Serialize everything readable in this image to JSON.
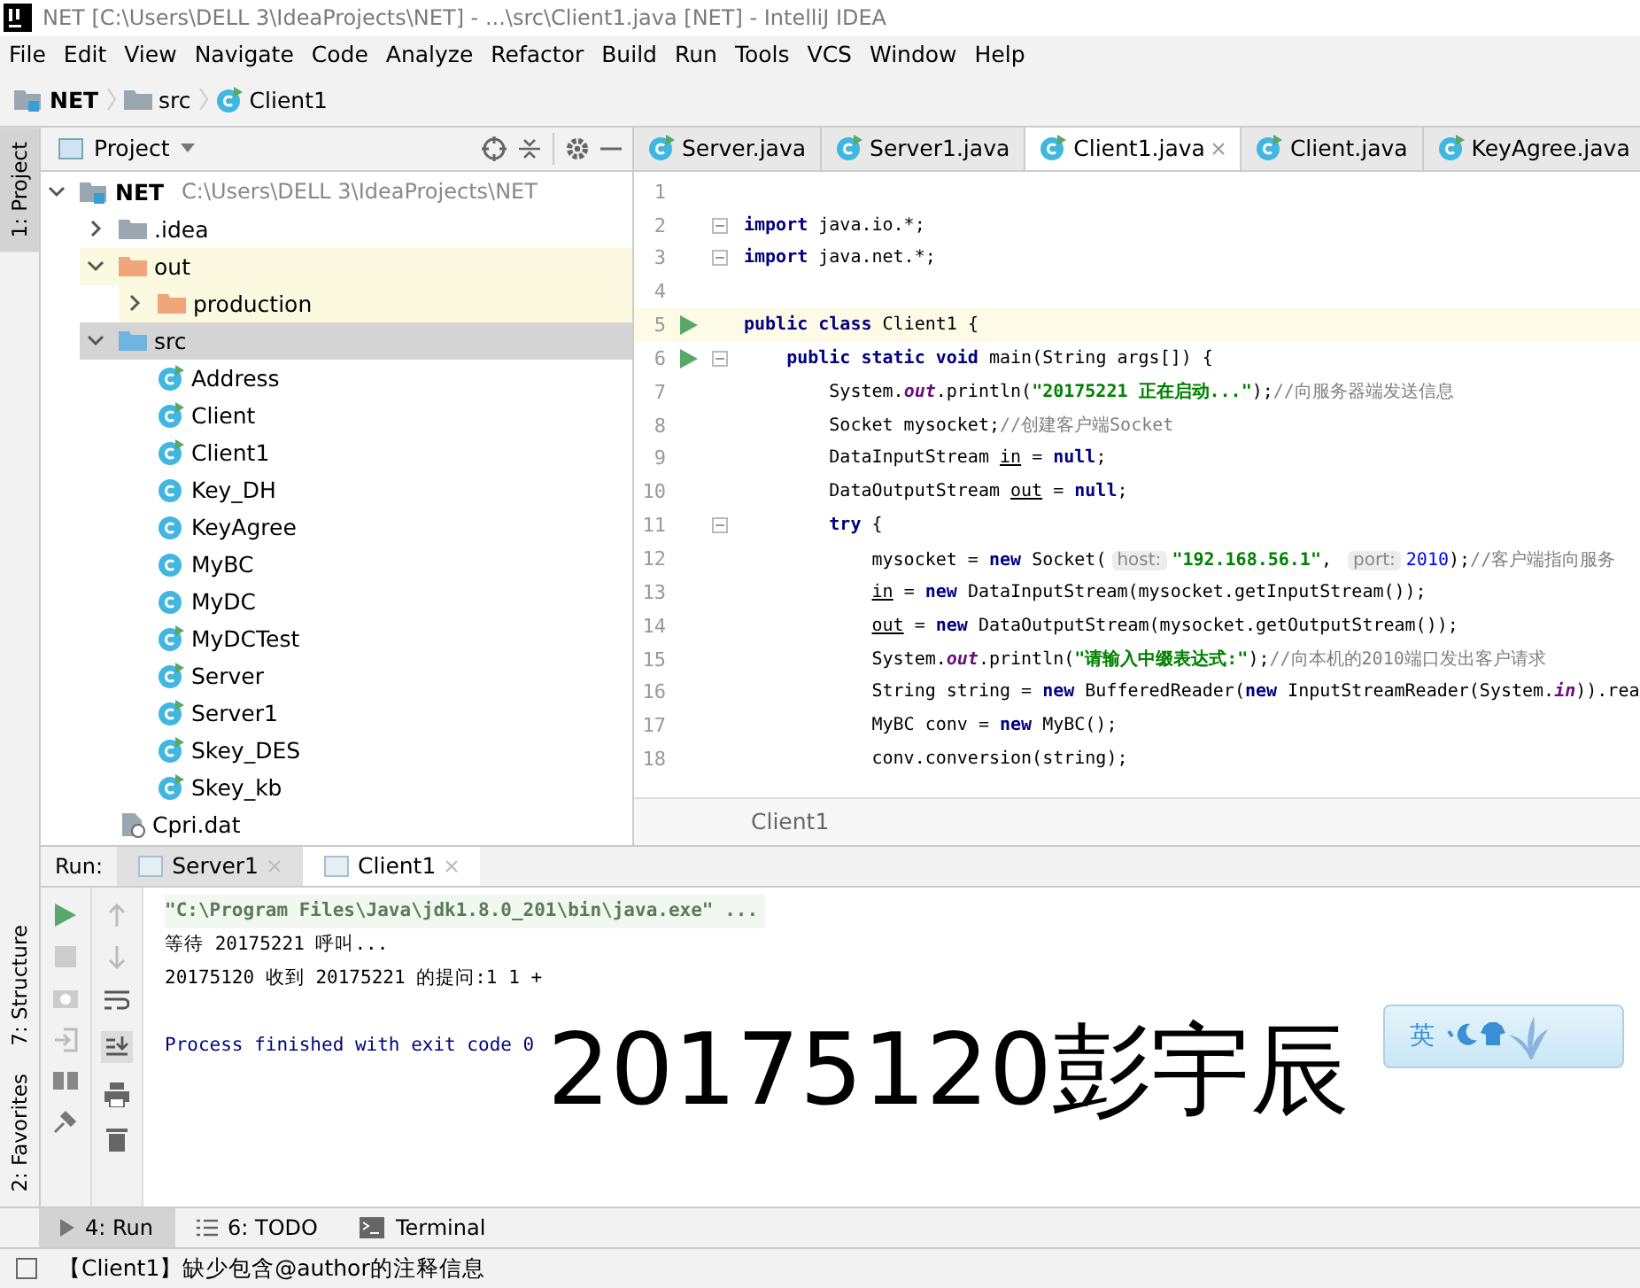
{
  "window": {
    "title": "NET [C:\\Users\\DELL 3\\IdeaProjects\\NET] - ...\\src\\Client1.java [NET] - IntelliJ IDEA"
  },
  "menu": [
    "File",
    "Edit",
    "View",
    "Navigate",
    "Code",
    "Analyze",
    "Refactor",
    "Build",
    "Run",
    "Tools",
    "VCS",
    "Window",
    "Help"
  ],
  "breadcrumb": [
    {
      "label": "NET",
      "kind": "module"
    },
    {
      "label": "src",
      "kind": "folder"
    },
    {
      "label": "Client1",
      "kind": "class"
    }
  ],
  "side_strip": [
    {
      "label": "1: Project",
      "selected": true
    },
    {
      "label": "7: Structure",
      "selected": false
    },
    {
      "label": "2: Favorites",
      "selected": false
    }
  ],
  "project_panel": {
    "title": "Project",
    "tree": [
      {
        "label": "NET",
        "path": "C:\\Users\\DELL 3\\IdeaProjects\\NET",
        "kind": "module",
        "expanded": true,
        "highlighted": false,
        "selected": false,
        "children": [
          {
            "label": ".idea",
            "kind": "folder",
            "expanded": false,
            "highlighted": false,
            "selected": false
          },
          {
            "label": "out",
            "kind": "excluded",
            "expanded": true,
            "highlighted": true,
            "selected": false,
            "children": [
              {
                "label": "production",
                "kind": "excluded",
                "expanded": false,
                "highlighted": true,
                "selected": false
              }
            ]
          },
          {
            "label": "src",
            "kind": "source",
            "expanded": true,
            "highlighted": false,
            "selected": true,
            "children": [
              {
                "label": "Address",
                "kind": "class",
                "runnable": true
              },
              {
                "label": "Client",
                "kind": "class",
                "runnable": true
              },
              {
                "label": "Client1",
                "kind": "class",
                "runnable": true
              },
              {
                "label": "Key_DH",
                "kind": "class",
                "runnable": false
              },
              {
                "label": "KeyAgree",
                "kind": "class",
                "runnable": false
              },
              {
                "label": "MyBC",
                "kind": "class",
                "runnable": false
              },
              {
                "label": "MyDC",
                "kind": "class",
                "runnable": false
              },
              {
                "label": "MyDCTest",
                "kind": "class",
                "runnable": true
              },
              {
                "label": "Server",
                "kind": "class",
                "runnable": true
              },
              {
                "label": "Server1",
                "kind": "class",
                "runnable": true
              },
              {
                "label": "Skey_DES",
                "kind": "class",
                "runnable": true
              },
              {
                "label": "Skey_kb",
                "kind": "class",
                "runnable": true
              }
            ]
          },
          {
            "label": "Cpri.dat",
            "kind": "file"
          }
        ]
      }
    ]
  },
  "editor": {
    "tabs": [
      {
        "label": "Server.java",
        "selected": false
      },
      {
        "label": "Server1.java",
        "selected": false
      },
      {
        "label": "Client1.java",
        "selected": true
      },
      {
        "label": "Client.java",
        "selected": false
      },
      {
        "label": "KeyAgree.java",
        "selected": false
      }
    ],
    "lines": [
      {
        "number": "1"
      },
      {
        "number": "2",
        "fold": true,
        "tokens": [
          {
            "text": "import",
            "kind": "keyword"
          },
          {
            "text": " java.io.*;",
            "kind": "plain"
          }
        ]
      },
      {
        "number": "3",
        "fold": true,
        "tokens": [
          {
            "text": "import",
            "kind": "keyword"
          },
          {
            "text": " java.net.*;",
            "kind": "plain"
          }
        ]
      },
      {
        "number": "4"
      },
      {
        "number": "5",
        "run": true,
        "current": true,
        "tokens": [
          {
            "text": "public class ",
            "kind": "keyword"
          },
          {
            "text": "Client1 {",
            "kind": "plain"
          }
        ]
      },
      {
        "number": "6",
        "run": true,
        "fold": true,
        "tokens": [
          {
            "text": "    public static void ",
            "kind": "keyword"
          },
          {
            "text": "main(String args[]) {",
            "kind": "plain"
          }
        ]
      },
      {
        "number": "7",
        "tokens": [
          {
            "text": "        System.",
            "kind": "plain"
          },
          {
            "text": "out",
            "kind": "static"
          },
          {
            "text": ".println(",
            "kind": "plain"
          },
          {
            "text": "\"20175221 正在启动...\"",
            "kind": "string"
          },
          {
            "text": ");",
            "kind": "plain"
          },
          {
            "text": "//向服务器端发送信息",
            "kind": "comment"
          }
        ]
      },
      {
        "number": "8",
        "tokens": [
          {
            "text": "        Socket mysocket;",
            "kind": "plain"
          },
          {
            "text": "//创建客户端Socket",
            "kind": "comment"
          }
        ]
      },
      {
        "number": "9",
        "tokens": [
          {
            "text": "        DataInputStream ",
            "kind": "plain"
          },
          {
            "text": "in",
            "kind": "underlined"
          },
          {
            "text": " = ",
            "kind": "plain"
          },
          {
            "text": "null",
            "kind": "keyword"
          },
          {
            "text": ";",
            "kind": "plain"
          }
        ]
      },
      {
        "number": "10",
        "tokens": [
          {
            "text": "        DataOutputStream ",
            "kind": "plain"
          },
          {
            "text": "out",
            "kind": "underlined"
          },
          {
            "text": " = ",
            "kind": "plain"
          },
          {
            "text": "null",
            "kind": "keyword"
          },
          {
            "text": ";",
            "kind": "plain"
          }
        ]
      },
      {
        "number": "11",
        "fold": true,
        "tokens": [
          {
            "text": "        try",
            "kind": "keyword"
          },
          {
            "text": " {",
            "kind": "plain"
          }
        ]
      },
      {
        "number": "12",
        "tokens": [
          {
            "text": "            mysocket = ",
            "kind": "plain"
          },
          {
            "text": "new",
            "kind": "keyword"
          },
          {
            "text": " Socket(",
            "kind": "plain"
          },
          {
            "text": "host:",
            "kind": "hint"
          },
          {
            "text": "\"192.168.56.1\"",
            "kind": "string"
          },
          {
            "text": ", ",
            "kind": "plain"
          },
          {
            "text": "port:",
            "kind": "hint"
          },
          {
            "text": "2010",
            "kind": "number"
          },
          {
            "text": ");",
            "kind": "plain"
          },
          {
            "text": "//客户端指向服务",
            "kind": "comment"
          }
        ]
      },
      {
        "number": "13",
        "tokens": [
          {
            "text": "            in",
            "kind": "underlined"
          },
          {
            "text": " = ",
            "kind": "plain"
          },
          {
            "text": "new",
            "kind": "keyword"
          },
          {
            "text": " DataInputStream(mysocket.getInputStream());",
            "kind": "plain"
          }
        ]
      },
      {
        "number": "14",
        "tokens": [
          {
            "text": "            out",
            "kind": "underlined"
          },
          {
            "text": " = ",
            "kind": "plain"
          },
          {
            "text": "new",
            "kind": "keyword"
          },
          {
            "text": " DataOutputStream(mysocket.getOutputStream());",
            "kind": "plain"
          }
        ]
      },
      {
        "number": "15",
        "tokens": [
          {
            "text": "            System.",
            "kind": "plain"
          },
          {
            "text": "out",
            "kind": "static"
          },
          {
            "text": ".println(",
            "kind": "plain"
          },
          {
            "text": "\"请输入中缀表达式:\"",
            "kind": "string"
          },
          {
            "text": ");",
            "kind": "plain"
          },
          {
            "text": "//向本机的2010端口发出客户请求",
            "kind": "comment"
          }
        ]
      },
      {
        "number": "16",
        "tokens": [
          {
            "text": "            String string = ",
            "kind": "plain"
          },
          {
            "text": "new",
            "kind": "keyword"
          },
          {
            "text": " BufferedReader(",
            "kind": "plain"
          },
          {
            "text": "new",
            "kind": "keyword"
          },
          {
            "text": " InputStreamReader(System.",
            "kind": "plain"
          },
          {
            "text": "in",
            "kind": "static"
          },
          {
            "text": ")).rea",
            "kind": "plain"
          }
        ]
      },
      {
        "number": "17",
        "tokens": [
          {
            "text": "            MyBC conv = ",
            "kind": "plain"
          },
          {
            "text": "new",
            "kind": "keyword"
          },
          {
            "text": " MyBC();",
            "kind": "plain"
          }
        ]
      },
      {
        "number": "18",
        "tokens": [
          {
            "text": "            conv.conversion(string);",
            "kind": "plain"
          }
        ]
      }
    ],
    "footer": "Client1"
  },
  "run_panel": {
    "label": "Run:",
    "tabs": [
      {
        "label": "Server1",
        "selected": false
      },
      {
        "label": "Client1",
        "selected": true
      }
    ],
    "console": [
      {
        "text": "\"C:\\Program Files\\Java\\jdk1.8.0_201\\bin\\java.exe\" ...",
        "kind": "command"
      },
      {
        "text": "等待 20175221 呼叫...",
        "kind": "output"
      },
      {
        "text": "20175120 收到 20175221 的提问:1 1 +",
        "kind": "output"
      },
      {
        "text": "Process finished with exit code 0",
        "kind": "exit"
      }
    ]
  },
  "overlay_text": "20175120彭宇辰",
  "ime_bar": {
    "label": "英"
  },
  "tool_tabs": [
    {
      "label": "4: Run",
      "kind": "run",
      "selected": true
    },
    {
      "label": "6: TODO",
      "kind": "todo",
      "selected": false
    },
    {
      "label": "Terminal",
      "kind": "terminal",
      "selected": false
    }
  ],
  "status_bar": "【Client1】缺少包含@author的注释信息"
}
